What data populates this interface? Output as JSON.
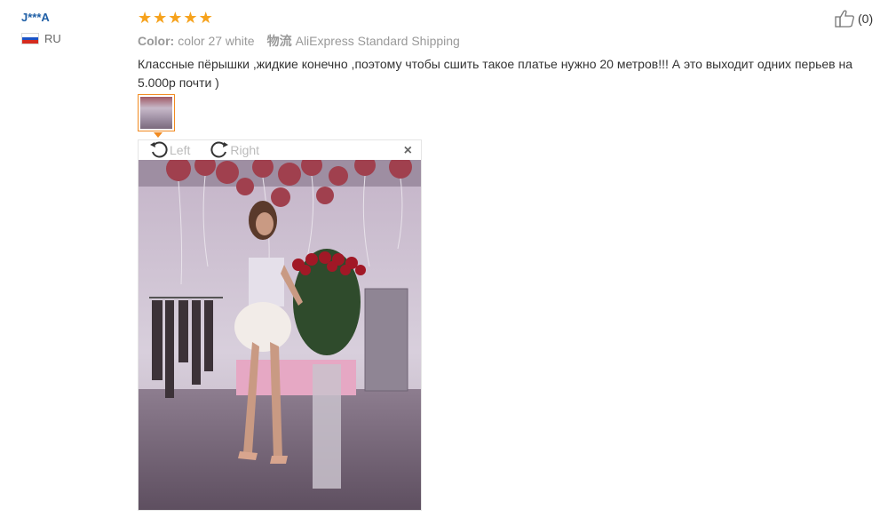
{
  "reviewer": {
    "name": "J***A",
    "country": "RU"
  },
  "review": {
    "rating": 5,
    "stars": [
      "★",
      "★",
      "★",
      "★",
      "★"
    ],
    "color_label": "Color:",
    "color_value": "color 27 white",
    "shipping_label": "物流",
    "shipping_value": "AliExpress Standard Shipping",
    "text": "Классные пёрышки ,жидкие конечно ,поэтому чтобы сшить такое платье нужно 20 метров!!! А это выходит одних перьев на 5.000р почти )",
    "helpful_count": "(0)"
  },
  "viewer": {
    "rotate_left": "Left",
    "rotate_right": "Right",
    "close": "×"
  },
  "colors": {
    "accent_orange": "#f18a20",
    "star": "#f6a21c",
    "username": "#1f5fa6"
  },
  "icons": [
    "russia-flag-icon",
    "star-icon",
    "thumbs-up-icon",
    "rotate-left-icon",
    "rotate-right-icon",
    "close-icon",
    "thumbnail-pointer-icon"
  ]
}
